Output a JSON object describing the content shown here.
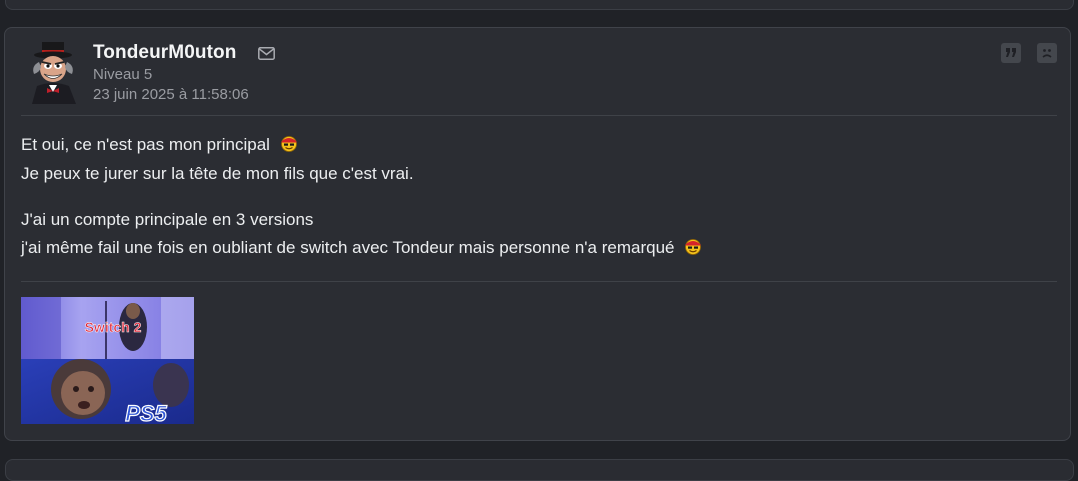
{
  "post": {
    "author": "TondeurM0uton",
    "level": "Niveau 5",
    "date": "23 juin 2025 à 11:58:06",
    "lines": [
      "Et oui, ce n'est pas mon principal",
      "Je peux te jurer sur la tête de mon fils que c'est vrai.",
      "J'ai un compte principale en 3 versions",
      "j'ai même fail une fois en oubliant de switch avec Tondeur mais personne n'a remarqué"
    ],
    "image_labels": {
      "top": "Switch 2",
      "bottom": "PS5"
    }
  },
  "icons": {
    "mail": "envelope-icon",
    "quote": "quote-icon",
    "report": "sad-face-icon",
    "smiley": "pirate-smiley-icon"
  },
  "colors": {
    "background": "#202227",
    "card": "#2b2d33",
    "text": "#eceef0",
    "muted": "#9a9ca2"
  }
}
